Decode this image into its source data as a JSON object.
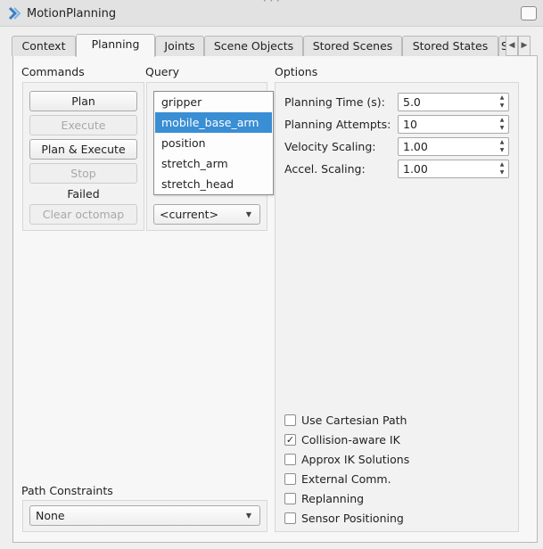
{
  "window": {
    "title": "MotionPlanning"
  },
  "tabs": [
    "Context",
    "Planning",
    "Joints",
    "Scene Objects",
    "Stored Scenes",
    "Stored States",
    "S"
  ],
  "commands": {
    "label": "Commands",
    "plan": "Plan",
    "execute": "Execute",
    "plan_execute": "Plan & Execute",
    "stop": "Stop",
    "status": "Failed",
    "clear_octomap": "Clear octomap"
  },
  "query": {
    "label": "Query",
    "groups": [
      "gripper",
      "mobile_base_arm",
      "position",
      "stretch_arm",
      "stretch_head"
    ],
    "selected_group": "mobile_base_arm",
    "goal_state": "<current>"
  },
  "options": {
    "label": "Options",
    "planning_time_label": "Planning Time (s):",
    "planning_time": "5.0",
    "planning_attempts_label": "Planning Attempts:",
    "planning_attempts": "10",
    "velocity_scaling_label": "Velocity Scaling:",
    "velocity_scaling": "1.00",
    "accel_scaling_label": "Accel. Scaling:",
    "accel_scaling": "1.00",
    "use_cartesian_path": "Use Cartesian Path",
    "collision_aware_ik": "Collision-aware IK",
    "approx_ik": "Approx IK Solutions",
    "external_comm": "External Comm.",
    "replanning": "Replanning",
    "sensor_positioning": "Sensor Positioning",
    "checked": {
      "collision_aware_ik": true
    }
  },
  "path_constraints": {
    "label": "Path Constraints",
    "value": "None"
  }
}
